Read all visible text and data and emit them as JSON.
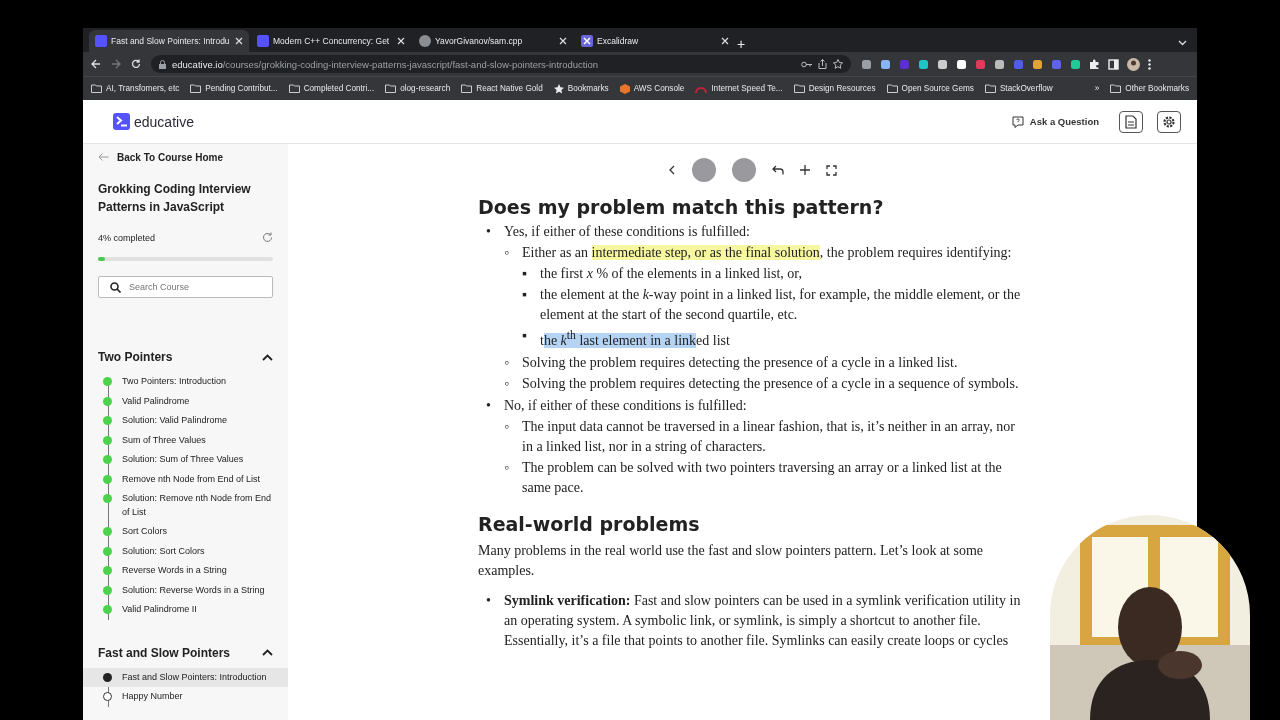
{
  "browser": {
    "tabs": [
      {
        "title": "Fast and Slow Pointers: Introdu",
        "selected": true,
        "kind": "square"
      },
      {
        "title": "Modern C++ Concurrency: Get",
        "selected": false,
        "kind": "square"
      },
      {
        "title": "YavorGivanov/sam.cpp",
        "selected": false,
        "kind": "round"
      },
      {
        "title": "Excalidraw",
        "selected": false,
        "kind": "cross"
      }
    ],
    "new_tab": "+",
    "url_host": "educative.io",
    "url_path": "/courses/grokking-coding-interview-patterns-javascript/fast-and-slow-pointers-introduction",
    "bookmarks": [
      {
        "label": "AI, Transfomers, etc",
        "kind": "folder"
      },
      {
        "label": "Pending Contribut...",
        "kind": "folder"
      },
      {
        "label": "Completed Contri...",
        "kind": "folder"
      },
      {
        "label": "olog-research",
        "kind": "folder"
      },
      {
        "label": "React Native Gold",
        "kind": "folder"
      },
      {
        "label": "Bookmarks",
        "kind": "star"
      },
      {
        "label": "AWS Console",
        "kind": "cube"
      },
      {
        "label": "Internet Speed Te...",
        "kind": "gauge"
      },
      {
        "label": "Design Resources",
        "kind": "folder"
      },
      {
        "label": "Open Source Gems",
        "kind": "folder"
      },
      {
        "label": "StackOverflow",
        "kind": "folder"
      }
    ],
    "more_bookmarks": "»",
    "other_bookmarks": "Other Bookmarks"
  },
  "header": {
    "logo": "educative",
    "ask": "Ask a Question"
  },
  "sidebar": {
    "back": "Back To Course Home",
    "course_title": "Grokking Coding Interview Patterns in JavaScript",
    "progress_text": "4% completed",
    "level": 0.04,
    "search": {
      "placeholder": "Search Course"
    },
    "sections": [
      {
        "title": "Two Pointers",
        "expanded": true,
        "lessons": [
          {
            "title": "Two Pointers: Introduction",
            "completed": true,
            "selected": false
          },
          {
            "title": "Valid Palindrome",
            "completed": true,
            "selected": false
          },
          {
            "title": "Solution: Valid Palindrome",
            "completed": true,
            "selected": false
          },
          {
            "title": "Sum of Three Values",
            "completed": true,
            "selected": false
          },
          {
            "title": "Solution: Sum of Three Values",
            "completed": true,
            "selected": false
          },
          {
            "title": "Remove nth Node from End of List",
            "completed": true,
            "selected": false
          },
          {
            "title": "Solution: Remove nth Node from End of List",
            "completed": true,
            "selected": false
          },
          {
            "title": "Sort Colors",
            "completed": true,
            "selected": false
          },
          {
            "title": "Solution: Sort Colors",
            "completed": true,
            "selected": false
          },
          {
            "title": "Reverse Words in a String",
            "completed": true,
            "selected": false
          },
          {
            "title": "Solution: Reverse Words in a String",
            "completed": true,
            "selected": false
          },
          {
            "title": "Valid Palindrome II",
            "completed": true,
            "selected": false
          }
        ]
      },
      {
        "title": "Fast and Slow Pointers",
        "expanded": true,
        "lessons": [
          {
            "title": "Fast and Slow Pointers: Introduction",
            "completed": false,
            "selected": true
          },
          {
            "title": "Happy Number",
            "completed": false,
            "selected": false
          }
        ]
      }
    ]
  },
  "content": {
    "heading_1": "Does my problem match this pattern?",
    "groups": [
      {
        "bullet": "•",
        "text": "Yes, if either of these conditions is fulfilled:",
        "items": [
          {
            "bullet": "◦",
            "parts": [
              {
                "text": "Either as an ",
                "highlighted": false
              },
              {
                "text": "intermediate step, or as the final solution",
                "highlighted": true
              },
              {
                "text": ", the problem requires identifying:",
                "highlighted": false
              }
            ],
            "children": [
              {
                "bullet": "▪",
                "parts": [
                  {
                    "text": "the first *x* % of the elements in a linked list, or,"
                  }
                ]
              },
              {
                "bullet": "▪",
                "parts": [
                  {
                    "text": "the element at the *k*-way point in a linked list, for example, the middle element, or the element at the start of the second quartile, etc."
                  }
                ]
              },
              {
                "bullet": "▪",
                "parts": [
                  {
                    "text": "t",
                    "selected": false
                  },
                  {
                    "text": "he *k*$^{th}$ last element in a link",
                    "selected": true
                  },
                  {
                    "text": "ed list",
                    "selected": false
                  }
                ]
              }
            ]
          },
          {
            "bullet": "◦",
            "parts": [
              {
                "text": "Solving the problem requires detecting the presence of a cycle in a linked list."
              }
            ]
          },
          {
            "bullet": "◦",
            "parts": [
              {
                "text": "Solving the problem requires detecting the presence of a cycle in a sequence of symbols."
              }
            ]
          }
        ]
      },
      {
        "bullet": "•",
        "text": "No, if either of these conditions is fulfilled:",
        "items": [
          {
            "bullet": "◦",
            "parts": [
              {
                "text": "The input data cannot be traversed in a linear fashion, that is, it’s neither in an array, nor in a linked list, nor in a string of characters."
              }
            ]
          },
          {
            "bullet": "◦",
            "parts": [
              {
                "text": "The problem can be solved with two pointers traversing an array or a linked list at the same pace."
              }
            ]
          }
        ]
      }
    ],
    "heading_2": "Real-world problems",
    "intro": "Many problems in the real world use the fast and slow pointers pattern. Let’s look at some examples.",
    "examples": [
      {
        "bullet": "•",
        "text": "**Symlink verification:** Fast and slow pointers can be used in a symlink verification utility in an operating system. A symbolic link, or symlink, is simply a shortcut to another file. Essentially, it’s a file that points to another file. Symlinks can easily create loops or cycles"
      }
    ]
  }
}
